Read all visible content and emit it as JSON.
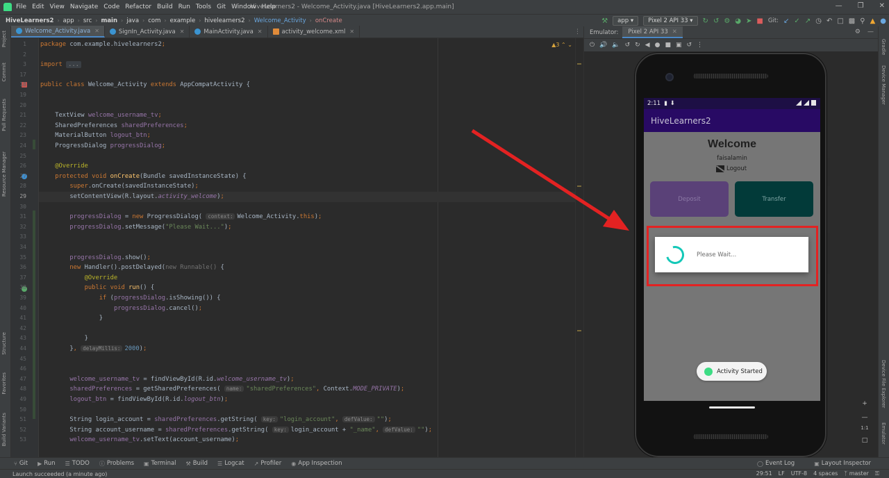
{
  "menu": [
    "File",
    "Edit",
    "View",
    "Navigate",
    "Code",
    "Refactor",
    "Build",
    "Run",
    "Tools",
    "Git",
    "Window",
    "Help"
  ],
  "window_title": "HiveLearners2 - Welcome_Activity.java [HiveLearners2.app.main]",
  "breadcrumbs": [
    "HiveLearners2",
    "app",
    "src",
    "main",
    "java",
    "com",
    "example",
    "hivelearners2",
    "Welcome_Activity",
    "onCreate"
  ],
  "toolbar": {
    "run_config": "app",
    "device": "Pixel 2 API 33",
    "git_label": "Git:"
  },
  "tabs": [
    {
      "label": "Welcome_Activity.java",
      "type": "java",
      "active": true
    },
    {
      "label": "SignIn_Activity.java",
      "type": "java",
      "active": false
    },
    {
      "label": "MainActivity.java",
      "type": "java",
      "active": false
    },
    {
      "label": "activity_welcome.xml",
      "type": "xml",
      "active": false
    }
  ],
  "left_strip": [
    "Project",
    "Commit",
    "Pull Requests",
    "Resource Manager",
    "Structure",
    "Favorites",
    "Build Variants"
  ],
  "right_strip": [
    "Gradle",
    "Device Manager",
    "Device File Explorer",
    "Emulator"
  ],
  "editor": {
    "warning_count": "3",
    "lines": [
      {
        "n": "1",
        "html": "<span class='kw'>package </span><span class='cls'>com.example.hivelearners2</span><span class='kw'>;</span>"
      },
      {
        "n": "2",
        "html": ""
      },
      {
        "n": "3",
        "html": "<span class='kw'>import </span><span class='folded'>...</span>"
      },
      {
        "n": "17",
        "html": ""
      },
      {
        "n": "18",
        "html": "<span class='kw'>public class </span><span class='cls'>Welcome_Activity </span><span class='kw'>extends </span><span class='cls'>AppCompatActivity {</span>"
      },
      {
        "n": "19",
        "html": ""
      },
      {
        "n": "20",
        "html": ""
      },
      {
        "n": "21",
        "html": "    <span class='cls'>TextView </span><span class='fld'>welcome_username_tv</span><span class='kw'>;</span>"
      },
      {
        "n": "22",
        "html": "    <span class='cls'>SharedPreferences </span><span class='fld'>sharedPreferences</span><span class='kw'>;</span>"
      },
      {
        "n": "23",
        "html": "    <span class='cls'>MaterialButton </span><span class='fld'>logout_btn</span><span class='kw'>;</span>"
      },
      {
        "n": "24",
        "html": "    <span class='cls'>ProgressDialog </span><span class='fld'>progressDialog</span><span class='kw'>;</span>"
      },
      {
        "n": "25",
        "html": ""
      },
      {
        "n": "26",
        "html": "    <span class='ann'>@Override</span>"
      },
      {
        "n": "27",
        "html": "    <span class='kw'>protected void </span><span class='fn'>onCreate</span><span class='cls'>(Bundle savedInstanceState) {</span>"
      },
      {
        "n": "28",
        "html": "        <span class='kw'>super</span><span class='cls'>.onCreate(savedInstanceState)</span><span class='kw'>;</span>"
      },
      {
        "n": "29",
        "html": "        <span class='cls'>setContentView(R.layout.</span><span class='itf'>activity_welcome</span><span class='cls'>)</span><span class='kw'>;</span>",
        "current": true
      },
      {
        "n": "30",
        "html": ""
      },
      {
        "n": "31",
        "html": "        <span class='fld'>progressDialog </span><span class='cls'>= </span><span class='kw'>new </span><span class='cls'>ProgressDialog( </span><span class='hint'>context:</span><span class='cls'>Welcome_Activity.</span><span class='kw'>this</span><span class='cls'>)</span><span class='kw'>;</span>"
      },
      {
        "n": "32",
        "html": "        <span class='fld'>progressDialog</span><span class='cls'>.setMessage(</span><span class='str'>\"Please Wait...\"</span><span class='cls'>)</span><span class='kw'>;</span>"
      },
      {
        "n": "33",
        "html": ""
      },
      {
        "n": "34",
        "html": ""
      },
      {
        "n": "35",
        "html": "        <span class='fld'>progressDialog</span><span class='cls'>.show()</span><span class='kw'>;</span>"
      },
      {
        "n": "36",
        "html": "        <span class='kw'>new </span><span class='cls'>Handler().postDelayed(</span><span class='dim'>new Runnable() </span><span class='cls'>{</span>"
      },
      {
        "n": "37",
        "html": "            <span class='ann'>@Override</span>"
      },
      {
        "n": "38",
        "html": "            <span class='kw'>public void </span><span class='fn'>run</span><span class='cls'>() {</span>"
      },
      {
        "n": "39",
        "html": "                <span class='kw'>if </span><span class='cls'>(</span><span class='fld'>progressDialog</span><span class='cls'>.isShowing()) {</span>"
      },
      {
        "n": "40",
        "html": "                    <span class='fld'>progressDialog</span><span class='cls'>.cancel()</span><span class='kw'>;</span>"
      },
      {
        "n": "41",
        "html": "                <span class='cls'>}</span>"
      },
      {
        "n": "42",
        "html": ""
      },
      {
        "n": "43",
        "html": "            <span class='cls'>}</span>"
      },
      {
        "n": "44",
        "html": "        <span class='cls'>}</span><span class='kw'>, </span><span class='hint'>delayMillis:</span><span class='num'>2000</span><span class='cls'>)</span><span class='kw'>;</span>"
      },
      {
        "n": "45",
        "html": ""
      },
      {
        "n": "46",
        "html": ""
      },
      {
        "n": "47",
        "html": "        <span class='fld'>welcome_username_tv </span><span class='cls'>= findViewById(R.id.</span><span class='itf'>welcome_username_tv</span><span class='cls'>)</span><span class='kw'>;</span>"
      },
      {
        "n": "48",
        "html": "        <span class='fld'>sharedPreferences </span><span class='cls'>= getSharedPreferences( </span><span class='hint'>name:</span><span class='str'>\"sharedPreferences\"</span><span class='kw'>, </span><span class='cls'>Context.</span><span class='itf'>MODE_PRIVATE</span><span class='cls'>)</span><span class='kw'>;</span>"
      },
      {
        "n": "49",
        "html": "        <span class='fld'>logout_btn </span><span class='cls'>= findViewById(R.id.</span><span class='itf'>logout_btn</span><span class='cls'>)</span><span class='kw'>;</span>"
      },
      {
        "n": "50",
        "html": ""
      },
      {
        "n": "51",
        "html": "        <span class='cls'>String login_account = </span><span class='fld'>sharedPreferences</span><span class='cls'>.getString( </span><span class='hint'>key:</span><span class='str'>\"login_account\"</span><span class='kw'>, </span><span class='hint'>defValue:</span><span class='str'>\"\"</span><span class='cls'>)</span><span class='kw'>;</span>"
      },
      {
        "n": "52",
        "html": "        <span class='cls'>String account_username = </span><span class='fld'>sharedPreferences</span><span class='cls'>.getString( </span><span class='hint'>key:</span><span class='cls'>login_account + </span><span class='str'>\"_name\"</span><span class='kw'>, </span><span class='hint'>defValue:</span><span class='str'>\"\"</span><span class='cls'>)</span><span class='kw'>;</span>"
      },
      {
        "n": "53",
        "html": "        <span class='fld'>welcome_username_tv</span><span class='cls'>.setText(account_username)</span><span class='kw'>;</span>"
      }
    ]
  },
  "emulator": {
    "panel_title": "Emulator:",
    "device_tab": "Pixel 2 API 33",
    "zoom_label": "1:1"
  },
  "phone": {
    "time": "2:11",
    "app_title": "HiveLearners2",
    "welcome": "Welcome",
    "username": "faisalamin",
    "logout": "Logout",
    "deposit": "Deposit",
    "transfer": "Transfer",
    "dialog_message": "Please Wait...",
    "toast": "Activity Started"
  },
  "bottom_tools": [
    "Git",
    "Run",
    "TODO",
    "Problems",
    "Terminal",
    "Build",
    "Logcat",
    "Profiler",
    "App Inspection"
  ],
  "bottom_right_tools": [
    "Event Log",
    "Layout Inspector"
  ],
  "status": {
    "message": "Launch succeeded (a minute ago)",
    "position": "29:51",
    "line_sep": "LF",
    "encoding": "UTF-8",
    "indent": "4 spaces",
    "branch": "master"
  },
  "colors": {
    "annotation_red": "#e32222",
    "teal_spinner": "#14c8b8",
    "appbar_purple": "#280a64"
  }
}
